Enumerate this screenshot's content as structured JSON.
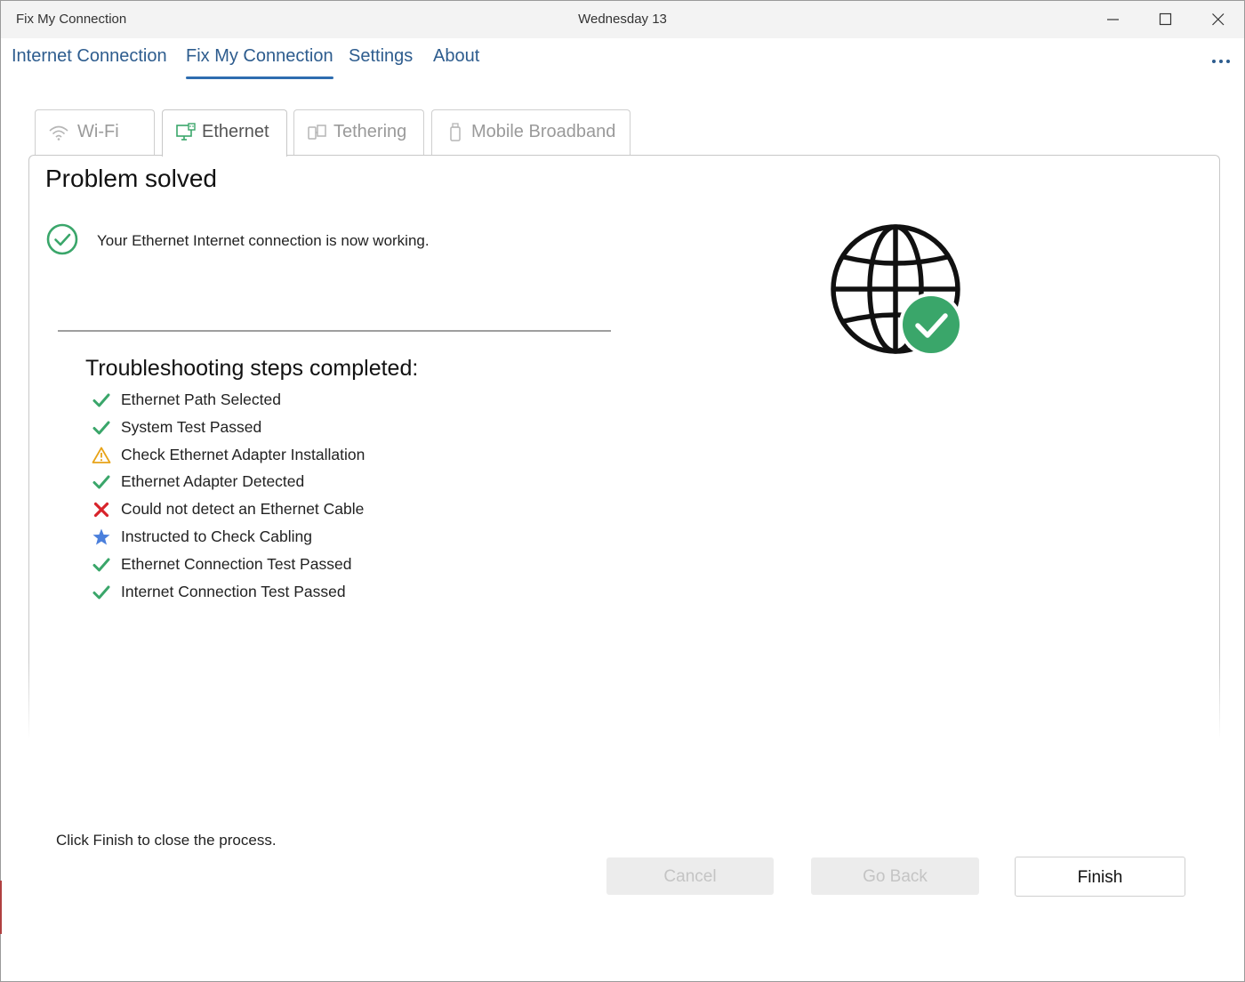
{
  "window": {
    "app_title": "Fix My Connection",
    "center_title": "Wednesday 13"
  },
  "nav": {
    "items": [
      {
        "label": "Internet Connection"
      },
      {
        "label": "Fix My Connection",
        "active": true
      },
      {
        "label": "Settings"
      },
      {
        "label": "About"
      }
    ],
    "more_icon": "more-horizontal-icon"
  },
  "tabs": [
    {
      "label": "Wi-Fi",
      "icon": "wifi-icon"
    },
    {
      "label": "Ethernet",
      "icon": "ethernet-icon",
      "active": true
    },
    {
      "label": "Tethering",
      "icon": "tethering-icon"
    },
    {
      "label": "Mobile Broadband",
      "icon": "mobile-broadband-icon"
    }
  ],
  "panel": {
    "title": "Problem solved",
    "status_message": "Your Ethernet Internet connection is now working.",
    "steps_heading": "Troubleshooting steps completed:",
    "steps": [
      {
        "label": "Ethernet Path Selected",
        "status": "success"
      },
      {
        "label": "System Test Passed",
        "status": "success"
      },
      {
        "label": "Check Ethernet Adapter Installation",
        "status": "warning"
      },
      {
        "label": "Ethernet Adapter Detected",
        "status": "success"
      },
      {
        "label": "Could not detect an Ethernet Cable",
        "status": "error"
      },
      {
        "label": "Instructed to Check Cabling",
        "status": "info"
      },
      {
        "label": "Ethernet Connection Test Passed",
        "status": "success"
      },
      {
        "label": "Internet Connection Test Passed",
        "status": "success"
      }
    ]
  },
  "footer": {
    "instruction": "Click Finish to close the process.",
    "cancel_label": "Cancel",
    "back_label": "Go Back",
    "finish_label": "Finish"
  },
  "colors": {
    "success": "#3aa66a",
    "warning": "#e8a317",
    "error": "#d8232a",
    "info": "#4a7fdc",
    "link": "#2d5c8e"
  }
}
